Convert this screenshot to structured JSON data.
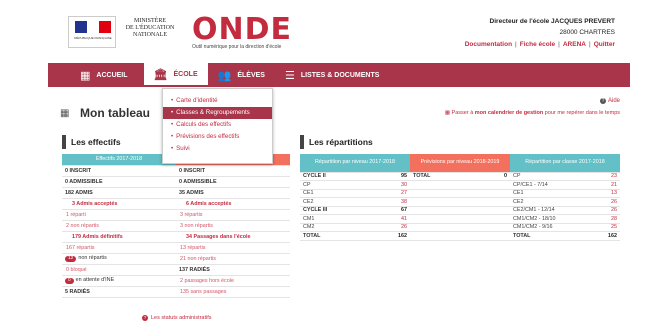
{
  "header": {
    "marianne_text": "RÉPUBLIQUE FRANÇAISE",
    "ministere": [
      "MINISTÈRE",
      "DE L'ÉDUCATION",
      "NATIONALE"
    ],
    "app_name": "ONDE",
    "app_subtitle": "Outil numérique pour la direction d'école",
    "director": "Directeur de l'école JACQUES PREVERT",
    "city": "28000 CHARTRES",
    "links": [
      "Documentation",
      "Fiche école",
      "ARENA",
      "Quitter"
    ]
  },
  "nav": {
    "items": [
      {
        "label": "ACCUEIL",
        "icon": "grid-icon"
      },
      {
        "label": "ÉCOLE",
        "icon": "school-icon"
      },
      {
        "label": "ÉLÈVES",
        "icon": "students-icon"
      },
      {
        "label": "LISTES & DOCUMENTS",
        "icon": "list-icon"
      }
    ]
  },
  "dropdown": {
    "items": [
      "Carte d'identité",
      "Classes & Regroupements",
      "Calculs des effectifs",
      "Prévisions des effectifs",
      "Suivi"
    ]
  },
  "page": {
    "title": "Mon tableau",
    "aide": "Aide",
    "calendar_prefix": "Passer à ",
    "calendar_link": "mon calendrier de gestion",
    "calendar_suffix": " pour me repérer dans le temps"
  },
  "effectifs": {
    "title": "Les effectifs",
    "col1_header": "Effectifs 2017-2018",
    "col1": [
      {
        "text": "0 INSCRIT",
        "style": "bold"
      },
      {
        "text": "0 ADMISSIBLE",
        "style": "bold"
      },
      {
        "text": "182 ADMIS",
        "style": "bold"
      },
      {
        "text": "3 Admis acceptés",
        "style": "red-bold"
      },
      {
        "text": "1 réparti",
        "style": "sub"
      },
      {
        "text": "2 non répartis",
        "style": "sub"
      },
      {
        "text": "179 Admis définitifs",
        "style": "red-bold"
      },
      {
        "text": "167 répartis",
        "style": "sub"
      },
      {
        "badge": "12",
        "text": "non répartis",
        "style": "badge"
      },
      {
        "text": "0 bloqué",
        "style": "sub"
      },
      {
        "badge": "0",
        "text": "en attente d'INE",
        "style": "badge"
      },
      {
        "text": "5 RADIÉS",
        "style": "bold"
      }
    ],
    "col2": [
      {
        "text": "0 INSCRIT",
        "style": "bold"
      },
      {
        "text": "0 ADMISSIBLE",
        "style": "bold"
      },
      {
        "text": "35 ADMIS",
        "style": "bold"
      },
      {
        "text": "6 Admis acceptés",
        "style": "red-bold"
      },
      {
        "text": "3 répartis",
        "style": "sub"
      },
      {
        "text": "3 non répartis",
        "style": "sub"
      },
      {
        "text": "34 Passages dans l'école",
        "style": "red-bold"
      },
      {
        "text": "13 répartis",
        "style": "sub"
      },
      {
        "text": "21 non répartis",
        "style": "sub"
      },
      {
        "text": "137 RADIÉS",
        "style": "bold"
      },
      {
        "text": "2 passages hors école",
        "style": "sub"
      },
      {
        "text": "135 sans passages",
        "style": "sub"
      }
    ],
    "statuts_link": "Les statuts administratifs"
  },
  "repartitions": {
    "title": "Les répartitions",
    "niveau_header": "Répartition par niveau 2017-2018",
    "prevus_header": "Prévisions par niveau 2018-2019",
    "classe_header": "Répartition par classe 2017-2018",
    "niveau": [
      {
        "label": "CYCLE II",
        "value": "95",
        "bold": true
      },
      {
        "label": "CP",
        "value": "30"
      },
      {
        "label": "CE1",
        "value": "27"
      },
      {
        "label": "CE2",
        "value": "38"
      },
      {
        "label": "CYCLE III",
        "value": "67",
        "bold": true
      },
      {
        "label": "CM1",
        "value": "41"
      },
      {
        "label": "CM2",
        "value": "26"
      },
      {
        "label": "TOTAL",
        "value": "162",
        "bold": true
      }
    ],
    "prevus": [
      {
        "label": "TOTAL",
        "value": "0",
        "bold": true
      }
    ],
    "classe": [
      {
        "label": "CP",
        "value": "23"
      },
      {
        "label": "CP/CE1 - 7/14",
        "value": "21"
      },
      {
        "label": "CE1",
        "value": "13"
      },
      {
        "label": "CE2",
        "value": "26"
      },
      {
        "label": "CE2/CM1 - 12/14",
        "value": "26"
      },
      {
        "label": "CM1/CM2 - 18/10",
        "value": "28"
      },
      {
        "label": "CM1/CM2 - 9/16",
        "value": "25"
      },
      {
        "label": "TOTAL",
        "value": "162",
        "bold": true
      }
    ]
  },
  "colors": {
    "brand": "#c32b3f",
    "nav": "#a8354a",
    "teal": "#62c0c6",
    "salmon": "#f2705d"
  }
}
